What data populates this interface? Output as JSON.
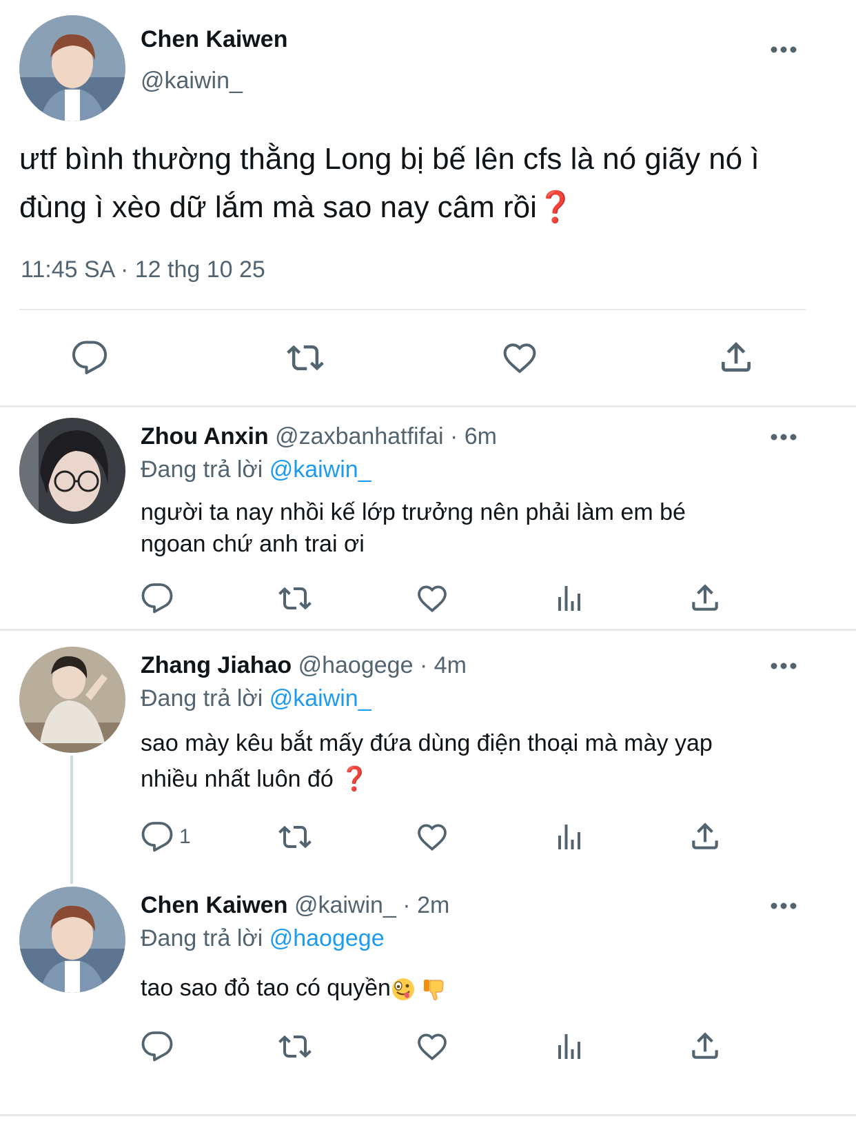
{
  "main_tweet": {
    "author_name": "Chen Kaiwen",
    "handle": "@kaiwin_",
    "text": "ưtf bình thường thằng Long bị bế lên cfs là nó giãy nó ì đùng ì xèo dữ lắm mà sao nay câm rồi",
    "emoji_end": "❓",
    "time": "11:45 SA",
    "separator": "·",
    "date": "12 thg 10 25",
    "avatar_icon": "avatar-chen-kaiwen"
  },
  "replies": [
    {
      "author_name": "Zhou Anxin",
      "handle": "@zaxbanhatfifai",
      "separator": "·",
      "time": "6m",
      "replying_prefix": "Đang trả lời",
      "replying_to": "@kaiwin_",
      "text_line1": "người ta nay nhồi kế lớp trưởng nên phải làm em bé",
      "text_line2": "ngoan chứ anh trai ơi",
      "reply_count": ""
    },
    {
      "author_name": "Zhang Jiahao",
      "handle": "@haogege",
      "separator": "·",
      "time": "4m",
      "replying_prefix": "Đang trả lời",
      "replying_to": "@kaiwin_",
      "text_line1": "sao mày kêu bắt mấy đứa dùng điện thoại mà mày yap",
      "text_line2": "nhiều nhất luôn đó",
      "emoji_end": "❓",
      "reply_count": "1"
    },
    {
      "author_name": "Chen Kaiwen",
      "handle": "@kaiwin_",
      "separator": "·",
      "time": "2m",
      "replying_prefix": "Đang trả lời",
      "replying_to": "@haogege",
      "text_line1": "tao sao đỏ tao có quyền",
      "emoji_icons": [
        "zany-face-emoji",
        "thumbs-down-emoji"
      ],
      "reply_count": ""
    }
  ],
  "colors": {
    "text": "#0f1419",
    "secondary": "#536471",
    "link": "#1d9bf0",
    "divider": "#e7eaed",
    "question_mark": "#e0245e"
  },
  "icons": [
    "reply-icon",
    "retweet-icon",
    "like-icon",
    "views-icon",
    "share-icon",
    "more-icon"
  ]
}
